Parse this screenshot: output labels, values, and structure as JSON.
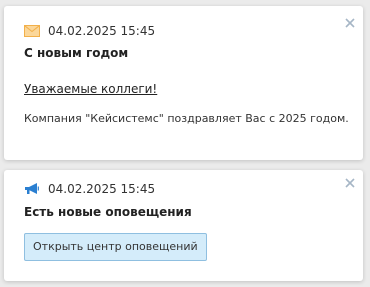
{
  "notifications": [
    {
      "icon": "envelope-icon",
      "timestamp": "04.02.2025 15:45",
      "title": "С новым годом",
      "link": "Уважаемые коллеги!",
      "body": "Компания \"Кейсистемс\" поздравляет Вас с 2025 годом."
    },
    {
      "icon": "megaphone-icon",
      "timestamp": "04.02.2025 15:45",
      "title": "Есть новые оповещения",
      "button": "Открыть центр оповещений"
    }
  ],
  "colors": {
    "background": "#ebebeb",
    "card": "#ffffff",
    "envelope": "#f2b04a",
    "megaphone": "#2a7fd1",
    "button_bg": "#d4ecfa",
    "button_border": "#8fbfe0",
    "close": "#a6b6c6"
  }
}
